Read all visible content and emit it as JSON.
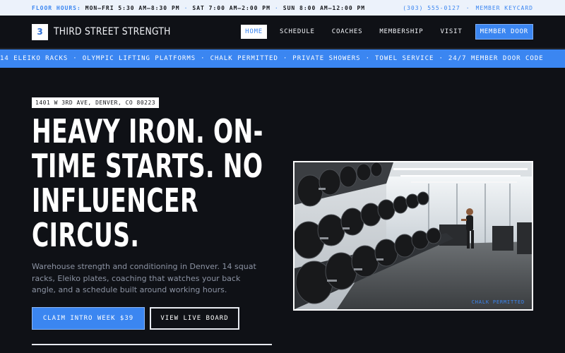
{
  "topbar": {
    "hours_label": "FLOOR HOURS:",
    "hours": [
      "MON–FRI 5:30 AM–8:30 PM",
      "SAT 7:00 AM–2:00 PM",
      "SUN 8:00 AM–12:00 PM"
    ],
    "phone": "(303) 555-0127",
    "keycard_link": "MEMBER KEYCARD"
  },
  "header": {
    "logo_mark": "3",
    "brand": "THIRD STREET STRENGTH",
    "nav": [
      "HOME",
      "SCHEDULE",
      "COACHES",
      "MEMBERSHIP",
      "VISIT"
    ],
    "active_nav": "HOME",
    "door_button": "MEMBER DOOR"
  },
  "marquee": {
    "items": [
      "14 ELEIKO RACKS",
      "OLYMPIC LIFTING PLATFORMS",
      "CHALK PERMITTED",
      "PRIVATE SHOWERS",
      "TOWEL SERVICE",
      "24/7 MEMBER DOOR CODE"
    ]
  },
  "hero": {
    "address": "1401 W 3RD AVE, DENVER, CO 80223",
    "headline": "HEAVY IRON. ON-TIME STARTS. NO INFLUENCER CIRCUS.",
    "description": "Warehouse strength and conditioning in Denver. 14 squat racks, Eleiko plates, coaching that watches your back angle, and a schedule built around working hours.",
    "primary_cta": "CLAIM INTRO WEEK $39",
    "secondary_cta": "VIEW LIVE BOARD",
    "photo_caption": "CHALK PERMITTED"
  },
  "colors": {
    "accent": "#3b86f1",
    "background": "#0f1116",
    "topbar_bg": "#ecf2fb"
  }
}
